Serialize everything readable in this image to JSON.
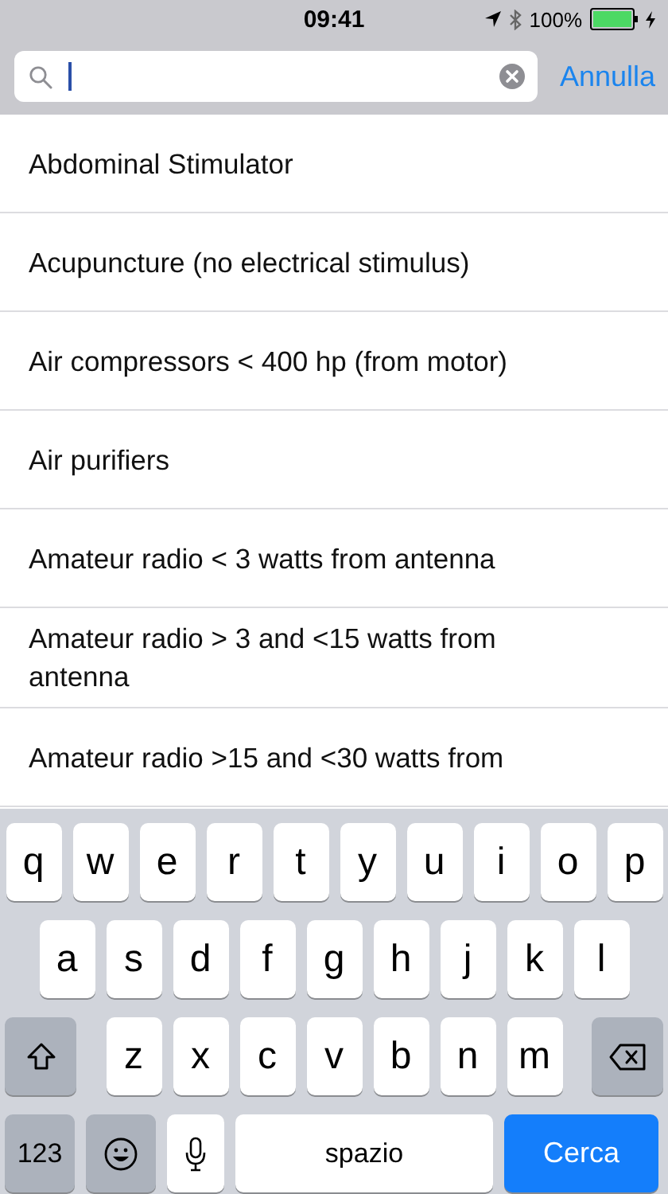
{
  "status_bar": {
    "time": "09:41",
    "battery": "100%",
    "charging": true
  },
  "search": {
    "clear_button": true,
    "cancel": "Annulla"
  },
  "results": [
    {
      "label": "Abdominal Stimulator"
    },
    {
      "label": "Acupuncture (no electrical stimulus)"
    },
    {
      "label": "Air compressors < 400 hp (from motor)"
    },
    {
      "label": "Air purifiers"
    },
    {
      "label": "Amateur radio < 3 watts from antenna"
    },
    {
      "label": "Amateur radio > 3 and <15 watts from antenna"
    },
    {
      "label": "Amateur radio >15 and <30 watts from"
    }
  ],
  "keyboard": {
    "rows": [
      [
        "q",
        "w",
        "e",
        "r",
        "t",
        "y",
        "u",
        "i",
        "o",
        "p"
      ],
      [
        "a",
        "s",
        "d",
        "f",
        "g",
        "h",
        "j",
        "k",
        "l"
      ],
      [
        "z",
        "x",
        "c",
        "v",
        "b",
        "n",
        "m"
      ]
    ],
    "numbers": "123",
    "space": "spazio",
    "action": "Cerca"
  }
}
